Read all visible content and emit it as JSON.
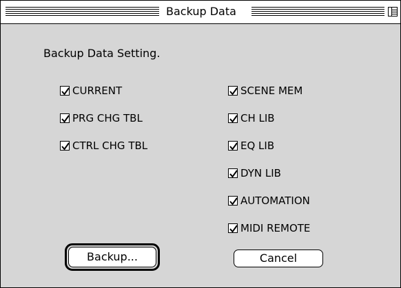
{
  "window": {
    "title": "Backup Data"
  },
  "dialog": {
    "subtitle": "Backup Data Setting."
  },
  "checkboxes": {
    "left": [
      {
        "label": "CURRENT",
        "checked": true
      },
      {
        "label": "PRG CHG TBL",
        "checked": true
      },
      {
        "label": "CTRL CHG TBL",
        "checked": true
      }
    ],
    "right": [
      {
        "label": "SCENE MEM",
        "checked": true
      },
      {
        "label": "CH LIB",
        "checked": true
      },
      {
        "label": "EQ LIB",
        "checked": true
      },
      {
        "label": "DYN LIB",
        "checked": true
      },
      {
        "label": "AUTOMATION",
        "checked": true
      },
      {
        "label": "MIDI REMOTE",
        "checked": true
      }
    ]
  },
  "buttons": {
    "backup_label": "Backup...",
    "cancel_label": "Cancel"
  },
  "colors": {
    "dialog_background": "#d6d6d6",
    "titlebar_background": "#ffffff"
  },
  "icons": [
    "checkmark-icon",
    "zoom-box-icon"
  ]
}
